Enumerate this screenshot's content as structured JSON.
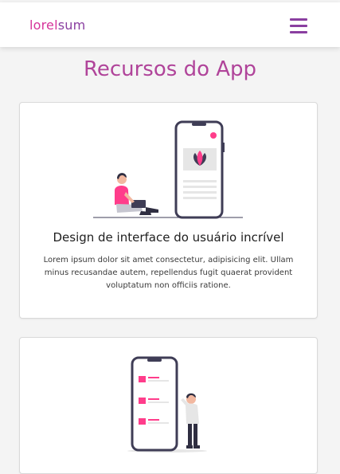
{
  "navbar": {
    "brand_part1": "lorel",
    "brand_part2": "sum",
    "menu_icon": "hamburger-menu-icon"
  },
  "main": {
    "section_title": "Recursos do App",
    "features": [
      {
        "illustration": "person-with-phone-illustration",
        "title": "Design de interface do usuário incrível",
        "description": "Lorem ipsum dolor sit amet consectetur, adipisicing elit. Ullam minus recusandae autem, repellendus fugit quaerat provident voluptatum non officiis ratione."
      },
      {
        "illustration": "person-thinking-phone-list-illustration"
      }
    ]
  },
  "colors": {
    "brand_pink": "#d6339a",
    "brand_purple": "#8a3fa0",
    "title_color": "#b0449a",
    "accent_pink": "#ff3d8b",
    "phone_dark": "#3f3d56"
  }
}
